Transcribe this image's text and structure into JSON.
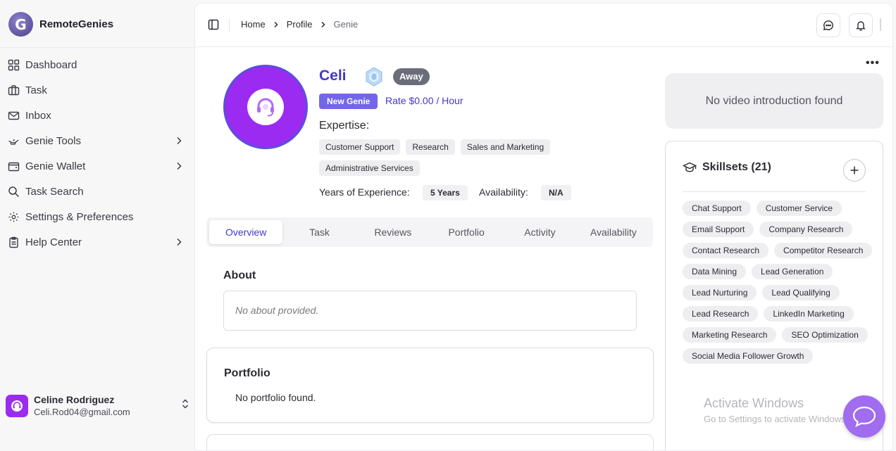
{
  "brand": {
    "name": "RemoteGenies",
    "logo_icon": "genie-logo-icon"
  },
  "sidebar": {
    "items": [
      {
        "label": "Dashboard",
        "icon": "grid-icon",
        "has_chevron": false
      },
      {
        "label": "Task",
        "icon": "briefcase-icon",
        "has_chevron": false
      },
      {
        "label": "Inbox",
        "icon": "mail-icon",
        "has_chevron": false
      },
      {
        "label": "Genie Tools",
        "icon": "genie-lamp-icon",
        "has_chevron": true
      },
      {
        "label": "Genie Wallet",
        "icon": "wallet-icon",
        "has_chevron": true
      },
      {
        "label": "Task Search",
        "icon": "search-icon",
        "has_chevron": false
      },
      {
        "label": "Settings & Preferences",
        "icon": "gear-icon",
        "has_chevron": false
      },
      {
        "label": "Help Center",
        "icon": "clipboard-icon",
        "has_chevron": true
      }
    ]
  },
  "user": {
    "name": "Celine Rodriguez",
    "email": "Celi.Rod04@gmail.com"
  },
  "topbar": {
    "breadcrumbs": [
      "Home",
      "Profile",
      "Genie"
    ]
  },
  "profile": {
    "name": "Celi",
    "status": "Away",
    "tier": "New Genie",
    "rate": "Rate $0.00 / Hour",
    "expertise_label": "Expertise:",
    "expertise": [
      "Customer Support",
      "Research",
      "Sales and Marketing",
      "Administrative Services"
    ],
    "years_label": "Years of Experience:",
    "years_value": "5 Years",
    "availability_label": "Availability:",
    "availability_value": "N/A"
  },
  "tabs": [
    "Overview",
    "Task",
    "Reviews",
    "Portfolio",
    "Activity",
    "Availability"
  ],
  "active_tab": "Overview",
  "about": {
    "title": "About",
    "empty": "No about provided."
  },
  "portfolio": {
    "title": "Portfolio",
    "empty": "No portfolio found."
  },
  "video": {
    "empty": "No video introduction found"
  },
  "skills": {
    "title": "Skillsets (21)",
    "items": [
      "Chat Support",
      "Customer Service",
      "Email Support",
      "Company Research",
      "Contact Research",
      "Competitor Research",
      "Data Mining",
      "Lead Generation",
      "Lead Nurturing",
      "Lead Qualifying",
      "Lead Research",
      "LinkedIn Marketing",
      "Marketing Research",
      "SEO Optimization",
      "Social Media Follower Growth"
    ]
  },
  "watermark": {
    "title": "Activate Windows",
    "subtitle": "Go to Settings to activate Windows."
  },
  "colors": {
    "accent": "#4338ca",
    "avatar_purple": "#9b2bf0",
    "tier_badge": "#7366e8",
    "status_badge": "#6b6e78",
    "chat_fab": "#a06cf0"
  }
}
